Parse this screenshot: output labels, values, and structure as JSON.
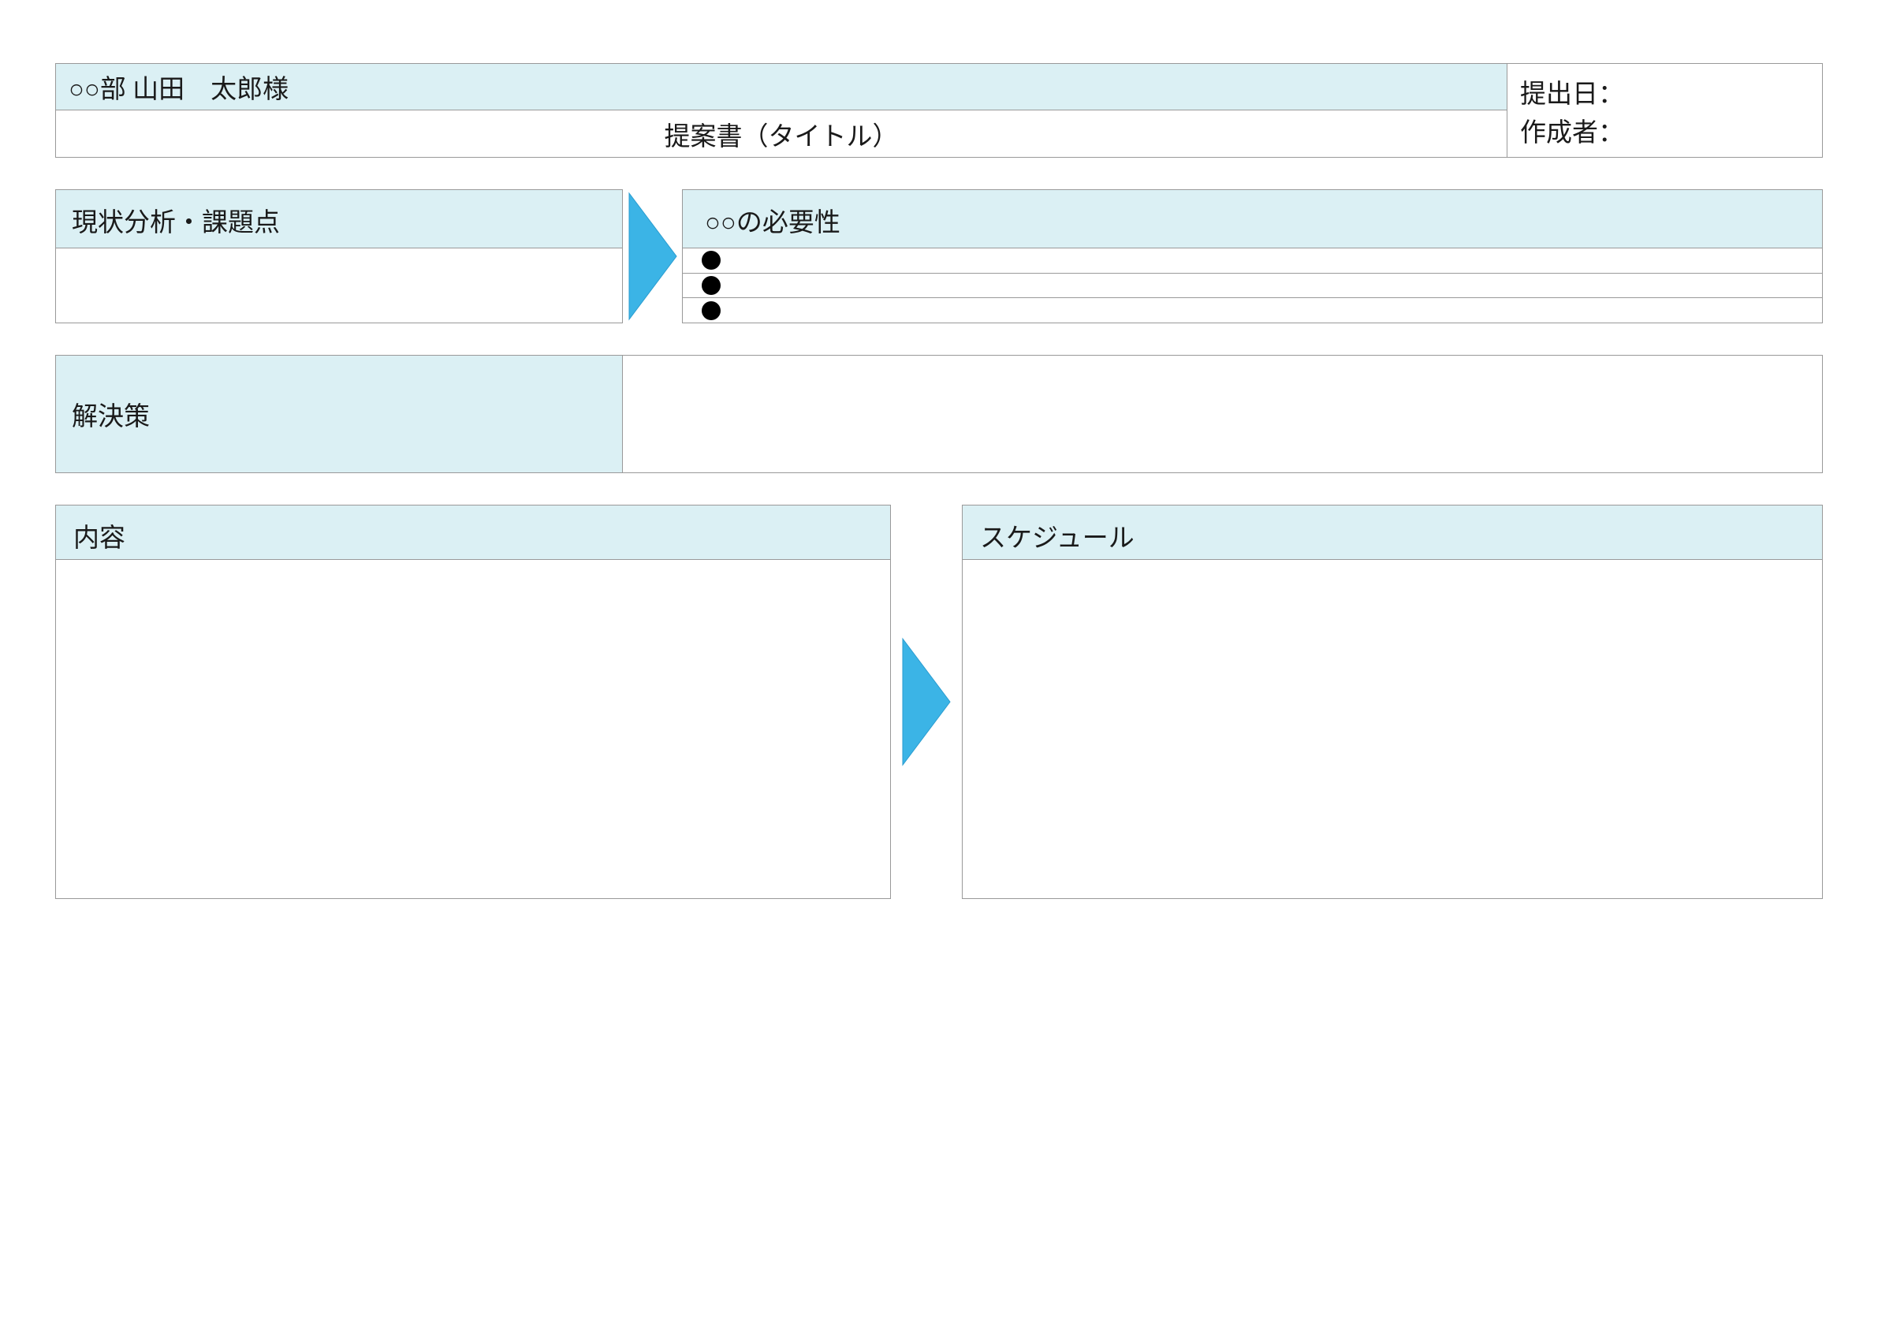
{
  "header": {
    "recipient": "○○部 山田　太郎様",
    "title": "提案書（タイトル）",
    "submission_date_label": "提出日：",
    "author_label": "作成者："
  },
  "sections": {
    "analysis_header": "現状分析・課題点",
    "necessity_header": "○○の必要性",
    "necessity_items": [
      "",
      "",
      ""
    ],
    "solution_header": "解決策",
    "content_header": "内容",
    "schedule_header": "スケジュール"
  },
  "colors": {
    "header_bg": "#dbf0f4",
    "arrow_fill": "#3bb4e6",
    "arrow_stroke": "#2a9cd0",
    "border": "#999999"
  }
}
